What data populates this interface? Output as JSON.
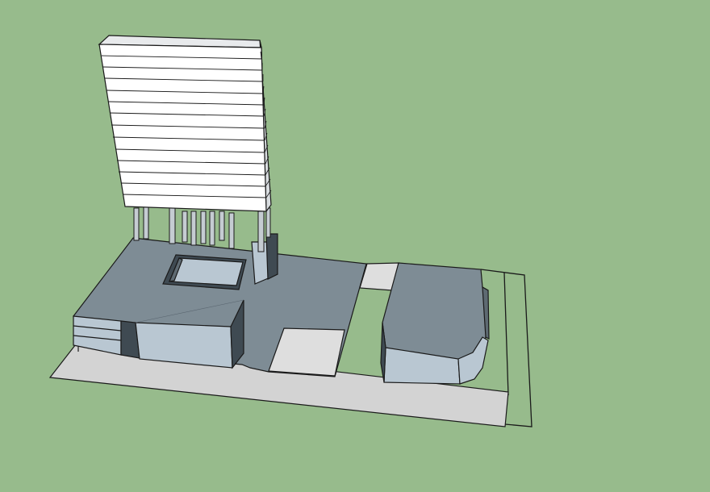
{
  "scene": {
    "background_color": "#97bb8c",
    "edge_color": "#1a1a1a",
    "colors": {
      "ground_slab": "#d3d3d3",
      "roof": "#7e8c95",
      "wall_light": "#b9c7d2",
      "wall_dark": "#3f4a52",
      "wall_mid": "#5e6a72",
      "tower_face": "#ffffff",
      "tower_side": "#d9dde0",
      "tower_top": "#e8eaec",
      "column": "#c5ccd2",
      "paving": "#dedede"
    },
    "objects": [
      "ground-slab",
      "podium-roof",
      "courtyard-opening",
      "entrance-block",
      "tower-columns",
      "tower-slab",
      "paved-plaza",
      "side-walkway",
      "annex-building",
      "site-boundary"
    ]
  }
}
